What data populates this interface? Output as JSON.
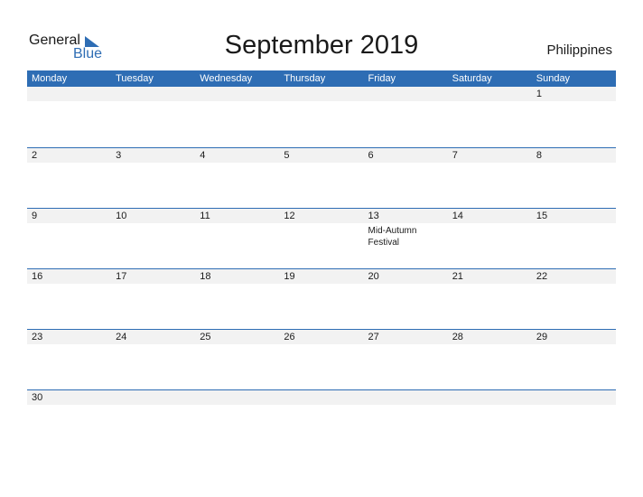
{
  "logo": {
    "general": "General",
    "blue": "Blue"
  },
  "title": "September 2019",
  "country": "Philippines",
  "weekdays": [
    "Monday",
    "Tuesday",
    "Wednesday",
    "Thursday",
    "Friday",
    "Saturday",
    "Sunday"
  ],
  "weeks": [
    [
      {
        "d": ""
      },
      {
        "d": ""
      },
      {
        "d": ""
      },
      {
        "d": ""
      },
      {
        "d": ""
      },
      {
        "d": ""
      },
      {
        "d": "1"
      }
    ],
    [
      {
        "d": "2"
      },
      {
        "d": "3"
      },
      {
        "d": "4"
      },
      {
        "d": "5"
      },
      {
        "d": "6"
      },
      {
        "d": "7"
      },
      {
        "d": "8"
      }
    ],
    [
      {
        "d": "9"
      },
      {
        "d": "10"
      },
      {
        "d": "11"
      },
      {
        "d": "12"
      },
      {
        "d": "13",
        "event": "Mid-Autumn Festival"
      },
      {
        "d": "14"
      },
      {
        "d": "15"
      }
    ],
    [
      {
        "d": "16"
      },
      {
        "d": "17"
      },
      {
        "d": "18"
      },
      {
        "d": "19"
      },
      {
        "d": "20"
      },
      {
        "d": "21"
      },
      {
        "d": "22"
      }
    ],
    [
      {
        "d": "23"
      },
      {
        "d": "24"
      },
      {
        "d": "25"
      },
      {
        "d": "26"
      },
      {
        "d": "27"
      },
      {
        "d": "28"
      },
      {
        "d": "29"
      }
    ],
    [
      {
        "d": "30"
      },
      {
        "d": ""
      },
      {
        "d": ""
      },
      {
        "d": ""
      },
      {
        "d": ""
      },
      {
        "d": ""
      },
      {
        "d": ""
      }
    ]
  ],
  "colors": {
    "accent": "#2e6db4",
    "row_band": "#f2f2f2"
  }
}
